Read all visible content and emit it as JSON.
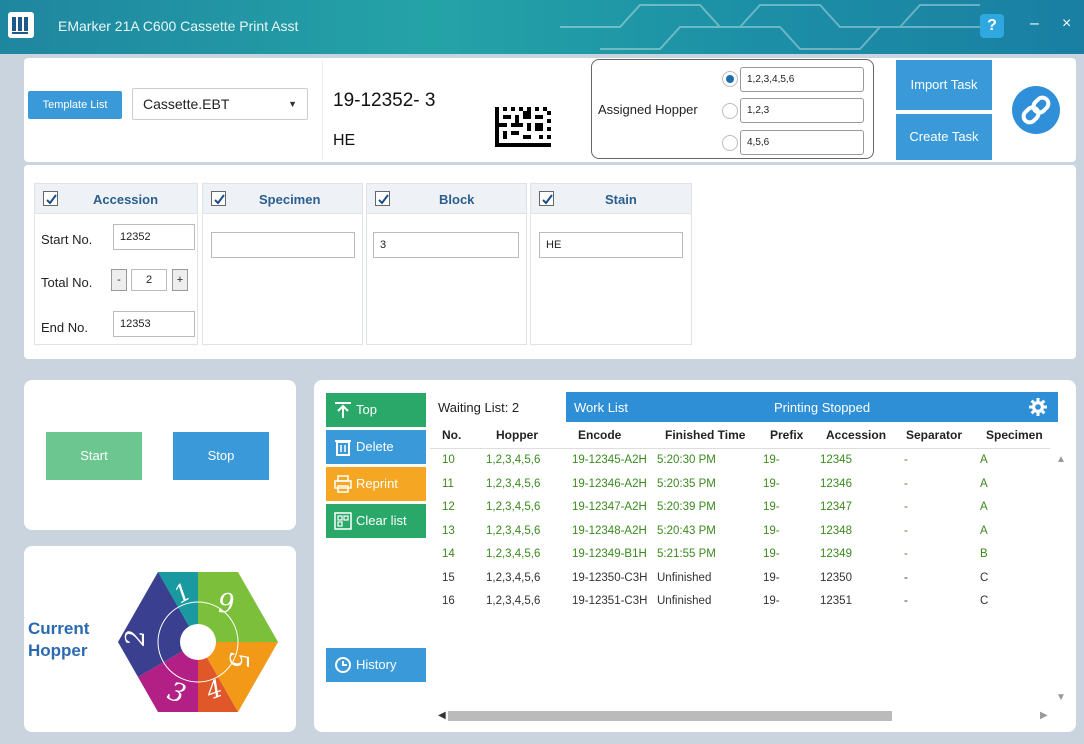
{
  "window": {
    "title": "EMarker 21A C600 Cassette Print Asst"
  },
  "template": {
    "button_label": "Template List",
    "selected": "Cassette.EBT"
  },
  "preview": {
    "line1": "19-12352-  3",
    "line2": "HE"
  },
  "hopper_assign": {
    "label": "Assigned Hopper",
    "options": [
      {
        "value": "1,2,3,4,5,6",
        "selected": true
      },
      {
        "value": "1,2,3",
        "selected": false
      },
      {
        "value": "4,5,6",
        "selected": false
      }
    ]
  },
  "actions": {
    "import": "Import Task",
    "create": "Create Task"
  },
  "fields": {
    "accession": {
      "header": "Accession",
      "checked": true,
      "start_label": "Start  No.",
      "start_value": "12352",
      "total_label": "Total No.",
      "total_value": "2",
      "end_label": "End   No.",
      "end_value": "12353",
      "minus": "-",
      "plus": "+"
    },
    "specimen": {
      "header": "Specimen",
      "checked": true,
      "value": ""
    },
    "block": {
      "header": "Block",
      "checked": true,
      "value": "3"
    },
    "stain": {
      "header": "Stain",
      "checked": true,
      "value": "HE"
    }
  },
  "control": {
    "start": "Start",
    "stop": "Stop"
  },
  "current_hopper": {
    "line1": "Current",
    "line2": "Hopper",
    "segments": [
      "1",
      "9",
      "5",
      "4",
      "3",
      "2"
    ]
  },
  "side_buttons": {
    "top": "Top",
    "delete": "Delete",
    "reprint": "Reprint",
    "clear": "Clear list",
    "history": "History"
  },
  "worklist": {
    "waiting": "Waiting List: 2",
    "title": "Work List",
    "status": "Printing Stopped",
    "columns": [
      "No.",
      "Hopper",
      "Encode",
      "Finished Time",
      "Prefix",
      "Accession",
      "Separator",
      "Specimen"
    ],
    "rows": [
      {
        "no": "10",
        "hopper": "1,2,3,4,5,6",
        "encode": "19-12345-A2H",
        "time": "5:20:30 PM",
        "prefix": "19-",
        "accession": "12345",
        "separator": "-",
        "specimen": "A",
        "done": true
      },
      {
        "no": "11",
        "hopper": "1,2,3,4,5,6",
        "encode": "19-12346-A2H",
        "time": "5:20:35 PM",
        "prefix": "19-",
        "accession": "12346",
        "separator": "-",
        "specimen": "A",
        "done": true
      },
      {
        "no": "12",
        "hopper": "1,2,3,4,5,6",
        "encode": "19-12347-A2H",
        "time": "5:20:39 PM",
        "prefix": "19-",
        "accession": "12347",
        "separator": "-",
        "specimen": "A",
        "done": true
      },
      {
        "no": "13",
        "hopper": "1,2,3,4,5,6",
        "encode": "19-12348-A2H",
        "time": "5:20:43 PM",
        "prefix": "19-",
        "accession": "12348",
        "separator": "-",
        "specimen": "A",
        "done": true
      },
      {
        "no": "14",
        "hopper": "1,2,3,4,5,6",
        "encode": "19-12349-B1H",
        "time": "5:21:55 PM",
        "prefix": "19-",
        "accession": "12349",
        "separator": "-",
        "specimen": "B",
        "done": true
      },
      {
        "no": "15",
        "hopper": "1,2,3,4,5,6",
        "encode": "19-12350-C3H",
        "time": "Unfinished",
        "prefix": "19-",
        "accession": "12350",
        "separator": "-",
        "specimen": "C",
        "done": false
      },
      {
        "no": "16",
        "hopper": "1,2,3,4,5,6",
        "encode": "19-12351-C3H",
        "time": "Unfinished",
        "prefix": "19-",
        "accession": "12351",
        "separator": "-",
        "specimen": "C",
        "done": false
      }
    ]
  },
  "colors": {
    "accent": "#3a9ad9",
    "start_green": "#6cc690",
    "reprint_orange": "#f5a623",
    "done_green": "#3a8a1e",
    "worklist_bar": "#2e8fd6"
  }
}
